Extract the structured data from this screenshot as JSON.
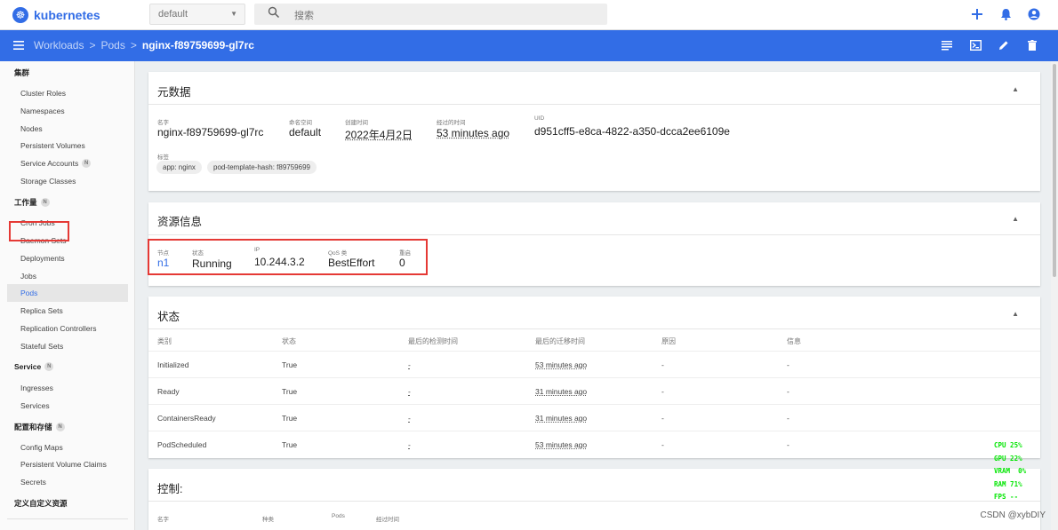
{
  "app": {
    "name": "kubernetes"
  },
  "topbar": {
    "namespace": "default",
    "search_placeholder": "搜索",
    "icons": [
      "plus-icon",
      "bell-icon",
      "account-icon"
    ]
  },
  "breadcrumb": {
    "items": [
      "Workloads",
      "Pods",
      "nginx-f89759699-gl7rc"
    ],
    "separator": ">"
  },
  "sidebar": {
    "groups": [
      {
        "label": "集群",
        "badge": "",
        "items": [
          "Cluster Roles",
          "Namespaces",
          "Nodes",
          "Persistent Volumes",
          "Service Accounts",
          "Storage Classes"
        ]
      },
      {
        "label": "工作量",
        "badge": "N",
        "items": [
          "Cron Jobs",
          "Daemon Sets",
          "Deployments",
          "Jobs",
          "Pods",
          "Replica Sets",
          "Replication Controllers",
          "Stateful Sets"
        ]
      },
      {
        "label": "Service",
        "badge": "N",
        "items": [
          "Ingresses",
          "Services"
        ]
      },
      {
        "label": "配置和存储",
        "badge": "N",
        "items": [
          "Config Maps",
          "Persistent Volume Claims",
          "Secrets"
        ]
      },
      {
        "label": "定义自定义资源",
        "badge": "",
        "items": []
      }
    ],
    "item_badge": "N",
    "active": "Pods"
  },
  "metadata": {
    "title": "元数据",
    "name_label": "名字",
    "name": "nginx-f89759699-gl7rc",
    "namespace_label": "命名空间",
    "namespace": "default",
    "created_label": "创建时间",
    "created": "2022年4月2日",
    "age_label": "经过的时间",
    "age": "53 minutes ago",
    "uid_label": "UID",
    "uid": "d951cff5-e8ca-4822-a350-dcca2ee6109e",
    "labels_label": "标签",
    "labels": [
      "app: nginx",
      "pod-template-hash: f89759699"
    ]
  },
  "resource": {
    "title": "资源信息",
    "node_label": "节点",
    "node": "n1",
    "status_label": "状态",
    "status": "Running",
    "ip_label": "IP",
    "ip": "10.244.3.2",
    "qos_label": "QoS 类",
    "qos": "BestEffort",
    "restarts_label": "重启",
    "restarts": "0"
  },
  "conditions": {
    "title": "状态",
    "headers": [
      "类别",
      "状态",
      "最后的检测时间",
      "最后的迁移时间",
      "原因",
      "信息"
    ],
    "rows": [
      [
        "Initialized",
        "True",
        "-",
        "53 minutes ago",
        "-",
        "-"
      ],
      [
        "Ready",
        "True",
        "-",
        "31 minutes ago",
        "-",
        "-"
      ],
      [
        "ContainersReady",
        "True",
        "-",
        "31 minutes ago",
        "-",
        "-"
      ],
      [
        "PodScheduled",
        "True",
        "-",
        "53 minutes ago",
        "-",
        "-"
      ]
    ]
  },
  "controller": {
    "title": "控制:",
    "name_label": "名字",
    "kind_label": "种类",
    "pods_label": "Pods",
    "age_label": "经过时间"
  },
  "hud": [
    "CPU 25%",
    "GPU 22%",
    "VRAM  0%",
    "RAM 71%",
    "FPS --"
  ],
  "watermark": "CSDN @xybDIY",
  "colors": {
    "brand": "#326de6",
    "highlight": "#e53935",
    "hud": "#00e600"
  }
}
